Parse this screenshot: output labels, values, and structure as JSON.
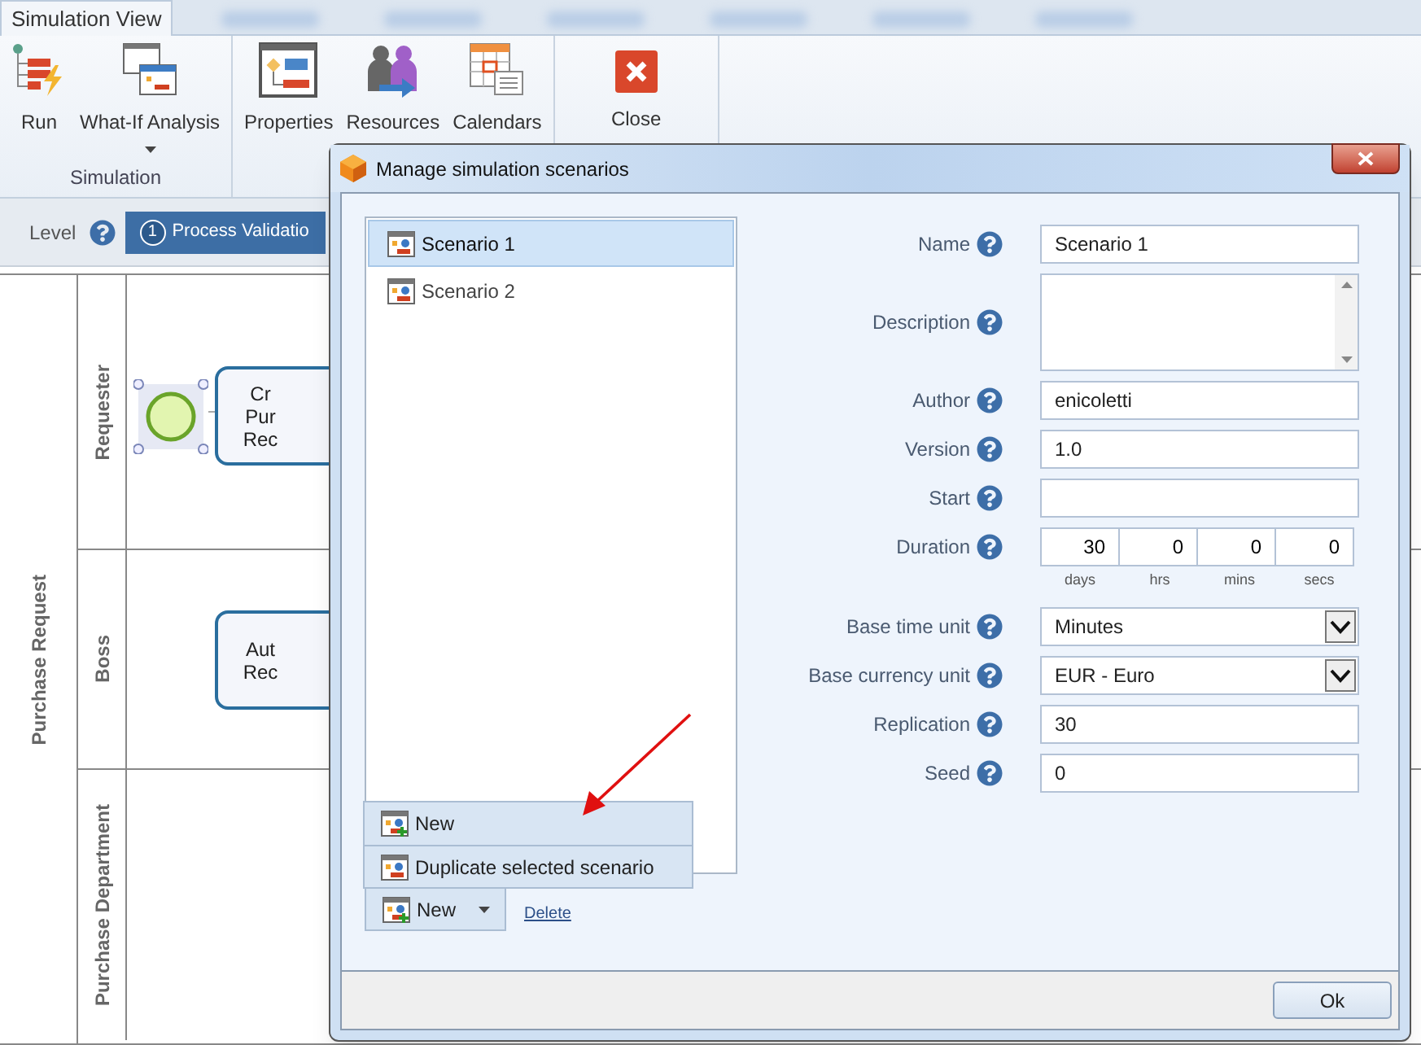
{
  "ribbon": {
    "tabs": [
      {
        "label": "Simulation View",
        "selected": true
      }
    ],
    "groups": [
      {
        "label": "Simulation",
        "buttons": [
          {
            "label": "Run",
            "dropdown": false
          },
          {
            "label": "What-If Analysis",
            "dropdown": true
          }
        ]
      },
      {
        "buttons": [
          {
            "label": "Properties",
            "dropdown": false
          },
          {
            "label": "Resources",
            "dropdown": false
          },
          {
            "label": "Calendars",
            "dropdown": false
          }
        ]
      },
      {
        "buttons": [
          {
            "label": "Close",
            "dropdown": false
          }
        ]
      }
    ]
  },
  "level_bar": {
    "label": "Level",
    "steps": [
      {
        "number": "1",
        "label": "Process Validatio",
        "selected": true
      }
    ]
  },
  "diagram": {
    "pool": "Purchase Request",
    "lanes": [
      {
        "name": "Requester",
        "start_event": {
          "selected": true
        },
        "task": [
          "Cr",
          "Pur",
          "Rec"
        ]
      },
      {
        "name": "Boss",
        "task": [
          "Aut",
          "Rec"
        ]
      },
      {
        "name": "Purchase Department"
      }
    ]
  },
  "dialog": {
    "title": "Manage simulation scenarios",
    "scenarios": [
      {
        "label": "Scenario 1",
        "selected": true
      },
      {
        "label": "Scenario 2",
        "selected": false
      }
    ],
    "menu": [
      {
        "label": "New"
      },
      {
        "label": "Duplicate selected scenario"
      }
    ],
    "new_button": {
      "label": "New"
    },
    "delete_link": "Delete",
    "fields": [
      {
        "kind": "text",
        "label": "Name",
        "value": "Scenario 1"
      },
      {
        "kind": "textarea",
        "label": "Description"
      },
      {
        "kind": "text",
        "label": "Author",
        "value": "enicoletti"
      },
      {
        "kind": "text",
        "label": "Version",
        "value": "1.0"
      },
      {
        "kind": "text",
        "label": "Start"
      },
      {
        "kind": "duration",
        "label": "Duration",
        "parts": [
          {
            "value": "30",
            "unit": "days"
          },
          {
            "value": "0",
            "unit": "hrs"
          },
          {
            "value": "0",
            "unit": "mins"
          },
          {
            "value": "0",
            "unit": "secs"
          }
        ]
      },
      {
        "kind": "select",
        "label": "Base time unit",
        "value": "Minutes"
      },
      {
        "kind": "select",
        "label": "Base currency unit",
        "value": "EUR - Euro"
      },
      {
        "kind": "text",
        "label": "Replication",
        "value": "30"
      },
      {
        "kind": "text",
        "label": "Seed",
        "value": "0"
      }
    ],
    "ok_button": "Ok"
  }
}
